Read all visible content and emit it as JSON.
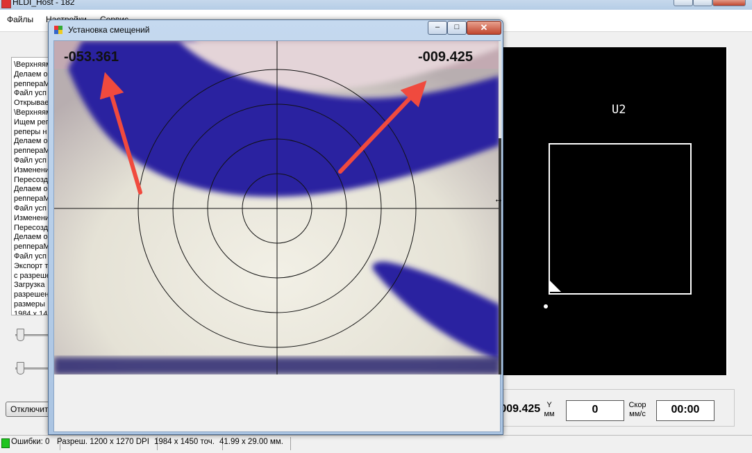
{
  "main_window": {
    "title": "HLDI_Host - 182",
    "menu": [
      "Файлы",
      "Настройки",
      "Сервис"
    ]
  },
  "log_lines": [
    "\\Верхняям",
    "Делаем о",
    "реппераМ",
    "Файл усп",
    "Открывае",
    "\\Верхняям",
    "Ищем реп",
    "реперы н",
    "Делаем о",
    "реппераМ",
    "Файл усп",
    "Изменени",
    "Пересозд",
    "Делаем о",
    "реппераМ",
    "Файл усп",
    "Изменени",
    "Пересозд",
    "Делаем о",
    "реппераМ",
    "Файл усп",
    "Экспорт т",
    "с разреше",
    "Загрузка",
    "разрешен",
    "размеры",
    "1984 x 14"
  ],
  "buttons": {
    "disconnect": "Отключить"
  },
  "preview": {
    "label": "U2"
  },
  "coords": {
    "x_value": "-009.425",
    "y_label": "Y\nмм",
    "y_value": "0",
    "speed_label": "Скор\nмм/с",
    "time_value": "00:00"
  },
  "status": {
    "errors": "Ошибки: 0",
    "resolution": "Разреш. 1200 x 1270 DPI",
    "points": "1984 x 1450 точ.",
    "size": "41.99 x 29.00 мм."
  },
  "dialog": {
    "title": "Установка смещений",
    "close_glyph": "✕",
    "min_glyph": "–",
    "max_glyph": "□",
    "offset_x": "-053.361",
    "offset_y": "-009.425"
  },
  "colors": {
    "status_led": "#1ec41e",
    "arrow": "#f04a3e",
    "ink_blue": "#2c22a0"
  }
}
